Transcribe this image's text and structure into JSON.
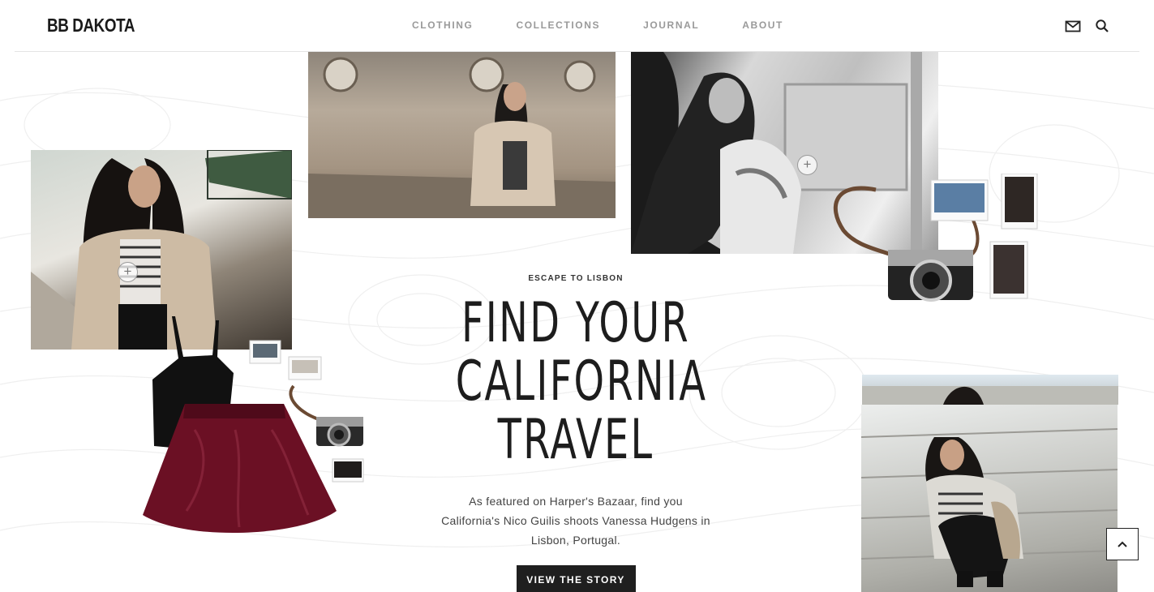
{
  "header": {
    "logo": "BB DAKOTA",
    "nav": [
      "CLOTHING",
      "COLLECTIONS",
      "JOURNAL",
      "ABOUT"
    ],
    "icons": [
      "mail-icon",
      "search-icon"
    ]
  },
  "hero": {
    "kicker": "ESCAPE TO LISBON",
    "headline": [
      "FIND YOUR",
      "CALIFORNIA",
      "TRAVEL"
    ],
    "description": "As featured on Harper's Bazaar, find you California's Nico Guilis shoots Vanessa Hudgens in Lisbon, Portugal.",
    "cta_label": "VIEW THE STORY"
  },
  "colors": {
    "nav_text": "#9a9a9a",
    "cta_bg": "#1f1f1f",
    "skirt": "#6b1024",
    "text": "#1d1d1d"
  },
  "scroll_top_icon": "chevron-up-icon"
}
